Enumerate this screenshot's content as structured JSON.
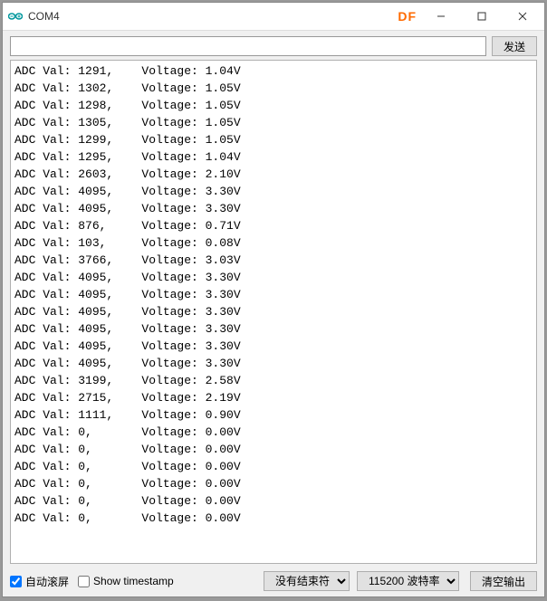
{
  "window": {
    "title": "COM4",
    "badge": "DF"
  },
  "input": {
    "value": "",
    "placeholder": ""
  },
  "buttons": {
    "send": "发送",
    "clear": "清空输出"
  },
  "bottom": {
    "autoscroll_label": "自动滚屏",
    "autoscroll_checked": true,
    "timestamp_label": "Show timestamp",
    "timestamp_checked": false,
    "line_ending_selected": "没有结束符",
    "baud_selected": "115200 波特率"
  },
  "serial_lines": [
    {
      "adc": "1291",
      "voltage": "1.04V"
    },
    {
      "adc": "1302",
      "voltage": "1.05V"
    },
    {
      "adc": "1298",
      "voltage": "1.05V"
    },
    {
      "adc": "1305",
      "voltage": "1.05V"
    },
    {
      "adc": "1299",
      "voltage": "1.05V"
    },
    {
      "adc": "1295",
      "voltage": "1.04V"
    },
    {
      "adc": "2603",
      "voltage": "2.10V"
    },
    {
      "adc": "4095",
      "voltage": "3.30V"
    },
    {
      "adc": "4095",
      "voltage": "3.30V"
    },
    {
      "adc": "876",
      "voltage": "0.71V"
    },
    {
      "adc": "103",
      "voltage": "0.08V"
    },
    {
      "adc": "3766",
      "voltage": "3.03V"
    },
    {
      "adc": "4095",
      "voltage": "3.30V"
    },
    {
      "adc": "4095",
      "voltage": "3.30V"
    },
    {
      "adc": "4095",
      "voltage": "3.30V"
    },
    {
      "adc": "4095",
      "voltage": "3.30V"
    },
    {
      "adc": "4095",
      "voltage": "3.30V"
    },
    {
      "adc": "4095",
      "voltage": "3.30V"
    },
    {
      "adc": "3199",
      "voltage": "2.58V"
    },
    {
      "adc": "2715",
      "voltage": "2.19V"
    },
    {
      "adc": "1111",
      "voltage": "0.90V"
    },
    {
      "adc": "0",
      "voltage": "0.00V"
    },
    {
      "adc": "0",
      "voltage": "0.00V"
    },
    {
      "adc": "0",
      "voltage": "0.00V"
    },
    {
      "adc": "0",
      "voltage": "0.00V"
    },
    {
      "adc": "0",
      "voltage": "0.00V"
    },
    {
      "adc": "0",
      "voltage": "0.00V"
    }
  ],
  "line_prefix": "ADC Val:",
  "voltage_prefix": "Voltage:"
}
